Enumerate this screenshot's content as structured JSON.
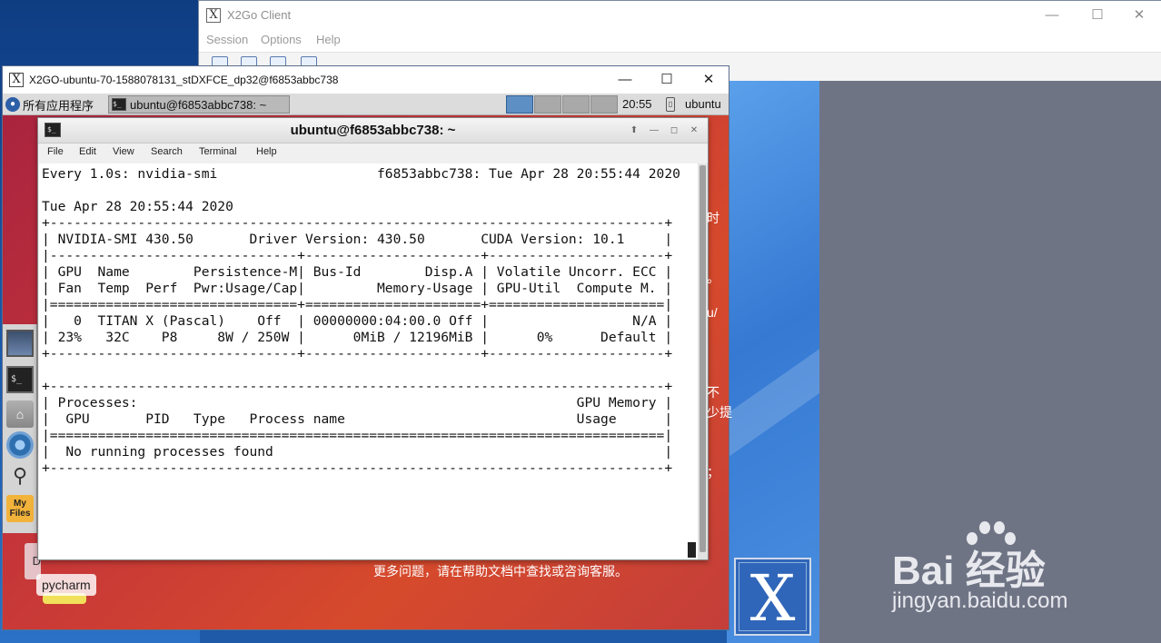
{
  "x2go_client": {
    "title": "X2Go Client",
    "menu": [
      "Session",
      "Options",
      "Help"
    ],
    "controls": {
      "minimize": "—",
      "maximize": "☐",
      "close": "✕"
    }
  },
  "session_window": {
    "title": "X2GO-ubuntu-70-1588078131_stDXFCE_dp32@f6853abbc738",
    "controls": {
      "minimize": "—",
      "maximize": "☐",
      "close": "✕"
    }
  },
  "panel": {
    "app_menu": "所有应用程序",
    "task_button": "ubuntu@f6853abbc738: ~",
    "clock": "20:55",
    "user": "ubuntu"
  },
  "desktop": {
    "pycharm_label": "pycharm",
    "d_label": "D",
    "help_text": "更多问题，请在帮助文档中查找或咨询客服。",
    "partial_texts": [
      "时",
      "。",
      "u/",
      "不",
      "少提",
      "；"
    ]
  },
  "terminal": {
    "title": "ubuntu@f6853abbc738: ~",
    "menu": [
      "File",
      "Edit",
      "View",
      "Search",
      "Terminal",
      "Help"
    ],
    "output_lines": [
      "Every 1.0s: nvidia-smi                    f6853abbc738: Tue Apr 28 20:55:44 2020",
      "",
      "Tue Apr 28 20:55:44 2020",
      "+-----------------------------------------------------------------------------+",
      "| NVIDIA-SMI 430.50       Driver Version: 430.50       CUDA Version: 10.1     |",
      "|-------------------------------+----------------------+----------------------+",
      "| GPU  Name        Persistence-M| Bus-Id        Disp.A | Volatile Uncorr. ECC |",
      "| Fan  Temp  Perf  Pwr:Usage/Cap|         Memory-Usage | GPU-Util  Compute M. |",
      "|===============================+======================+======================|",
      "|   0  TITAN X (Pascal)    Off  | 00000000:04:00.0 Off |                  N/A |",
      "| 23%   32C    P8     8W / 250W |      0MiB / 12196MiB |      0%      Default |",
      "+-------------------------------+----------------------+----------------------+",
      "",
      "+-----------------------------------------------------------------------------+",
      "| Processes:                                                       GPU Memory |",
      "|  GPU       PID   Type   Process name                             Usage      |",
      "|=============================================================================|",
      "|  No running processes found                                                 |",
      "+-----------------------------------------------------------------------------+"
    ]
  },
  "watermark": {
    "brand": "Bai  经验",
    "url": "jingyan.baidu.com"
  },
  "colors": {
    "desktop_red": "#c4343a",
    "panel_gray": "#dcdcdc",
    "workspace_active": "#5e8fc4",
    "bg_gray": "#6f7485"
  }
}
